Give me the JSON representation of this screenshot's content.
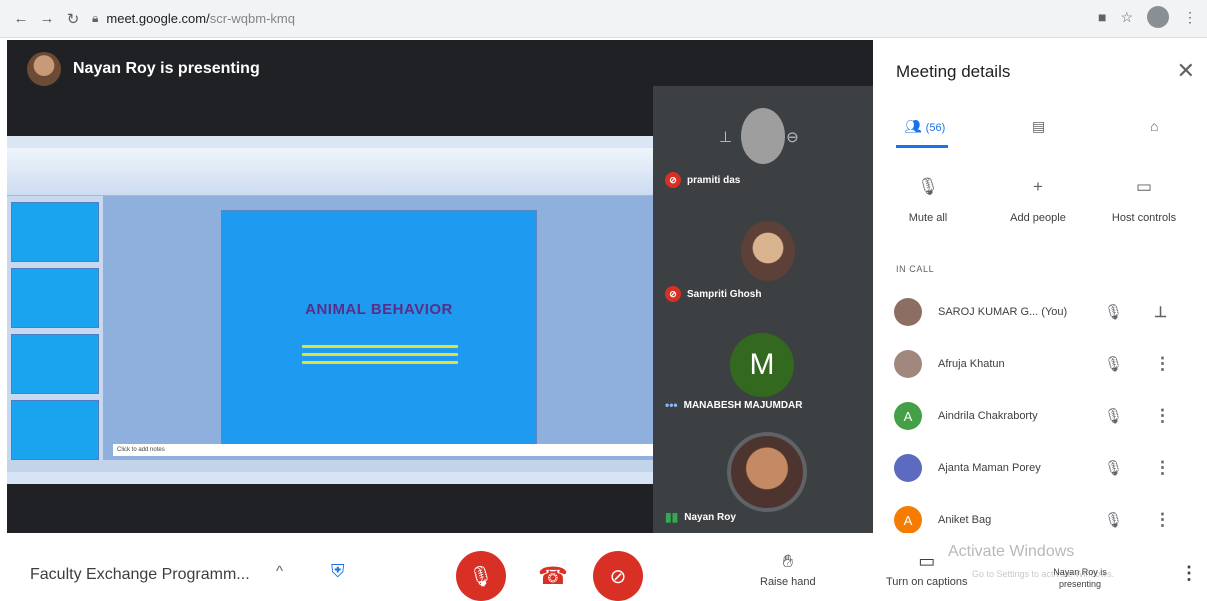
{
  "browser": {
    "url_host": "meet.google.com/",
    "url_path": "scr-wqbm-kmq",
    "icons": [
      "back-icon",
      "forward-icon",
      "reload-icon",
      "lock-icon",
      "camera-icon",
      "star-icon",
      "profile-avatar",
      "menu-icon"
    ]
  },
  "stage": {
    "presenter_text": "Nayan Roy is presenting",
    "slide": {
      "title": "ANIMAL BEHAVIOR",
      "notes_placeholder": "Click to add notes"
    }
  },
  "tiles": [
    {
      "name": "pramiti das",
      "muted": true
    },
    {
      "name": "Sampriti Ghosh",
      "muted": true
    },
    {
      "name": "MANABESH MAJUMDAR",
      "muted": false,
      "initial": "M",
      "status_icon": "more-dots"
    },
    {
      "name": "Nayan Roy",
      "muted": false,
      "status_icon": "speaking-bars"
    }
  ],
  "panel": {
    "title": "Meeting details",
    "tabs": [
      {
        "label": "(56)",
        "icon": "people-icon",
        "active": true
      },
      {
        "label": "",
        "icon": "chat-icon",
        "active": false
      },
      {
        "label": "",
        "icon": "activities-icon",
        "active": false
      }
    ],
    "actions": [
      {
        "label": "Mute all",
        "icon": "mic-off-icon"
      },
      {
        "label": "Add people",
        "icon": "person-add-icon"
      },
      {
        "label": "Host controls",
        "icon": "host-controls-icon"
      }
    ],
    "in_call_label": "IN CALL",
    "people": [
      {
        "name": "SAROJ KUMAR G... (You)",
        "avatar_color": "#8d6e63",
        "initial": ""
      },
      {
        "name": "Afruja Khatun",
        "avatar_color": "#a1887f",
        "initial": ""
      },
      {
        "name": "Aindrila Chakraborty",
        "avatar_color": "#43a047",
        "initial": "A"
      },
      {
        "name": "Ajanta Maman Porey",
        "avatar_color": "#5c6bc0",
        "initial": ""
      },
      {
        "name": "Aniket Bag",
        "avatar_color": "#f57c00",
        "initial": "A"
      }
    ]
  },
  "bottom": {
    "meeting_name": "Faculty Exchange Programm...",
    "raise_hand": "Raise hand",
    "captions": "Turn on captions",
    "watermark": "Activate Windows",
    "watermark_sub": "Go to Settings to activate Windows.",
    "presenting_note": "Nayan Roy is presenting"
  },
  "colors": {
    "red": "#d93025",
    "blue": "#1a73e8",
    "stage_bg": "#202124"
  }
}
